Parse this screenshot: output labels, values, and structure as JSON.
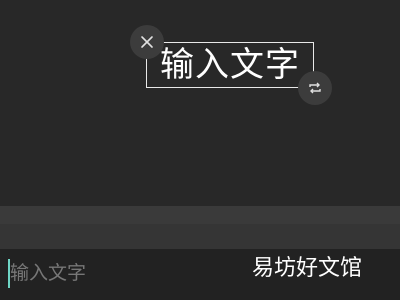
{
  "canvas": {
    "text_layer": {
      "content": "输入文字"
    },
    "close_handle": {
      "icon": "close-icon"
    },
    "rotate_handle": {
      "icon": "rotate-icon"
    }
  },
  "input_bar": {
    "placeholder": "输入文字",
    "value": ""
  },
  "watermark": {
    "text": "易坊好文馆"
  },
  "colors": {
    "background": "#282828",
    "caret": "#6fd6c6",
    "text": "#ffffff",
    "placeholder": "#777777"
  }
}
